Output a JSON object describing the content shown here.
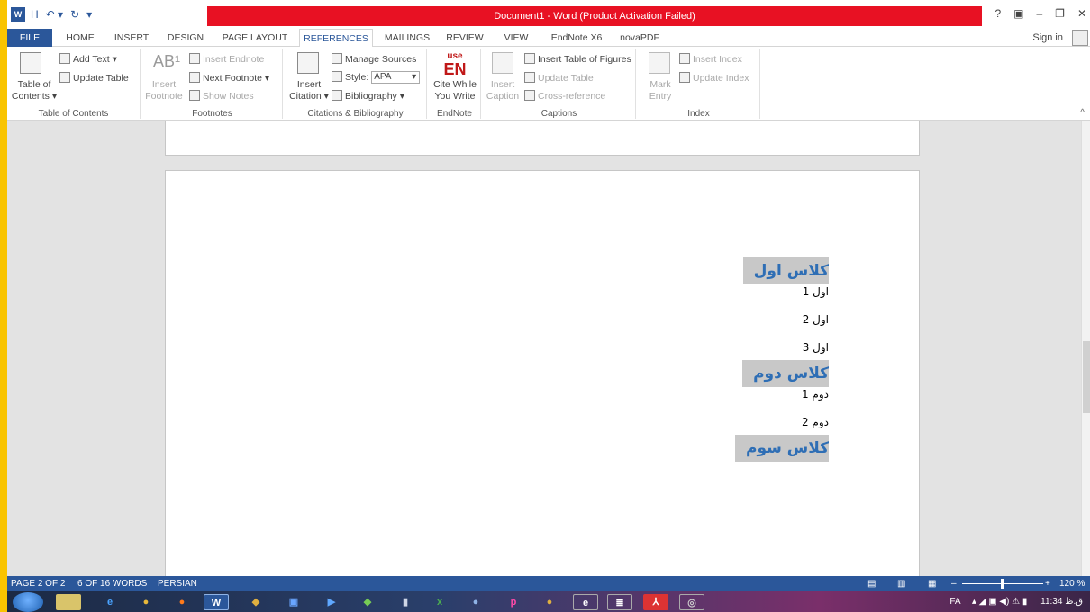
{
  "window": {
    "title": "Document1 - Word (Product Activation Failed)",
    "help": "?",
    "minimize": "–",
    "restore": "❐",
    "close": "✕"
  },
  "qat": {
    "save": "H",
    "undo": "↶ ▾",
    "redo": "↻"
  },
  "tabs": [
    "FILE",
    "HOME",
    "INSERT",
    "DESIGN",
    "PAGE LAYOUT",
    "REFERENCES",
    "MAILINGS",
    "REVIEW",
    "VIEW",
    "EndNote X6",
    "novaPDF"
  ],
  "sign_in": "Sign in",
  "ribbon": {
    "toc": {
      "table_of_contents": "Table of",
      "table_of_contents2": "Contents ▾",
      "add_text": "Add Text ▾",
      "update_table": "Update Table",
      "label": "Table of Contents"
    },
    "footnotes": {
      "insert_footnote": "Insert",
      "insert_footnote2": "Footnote",
      "insert_endnote": "Insert Endnote",
      "next_footnote": "Next Footnote ▾",
      "show_notes": "Show Notes",
      "label": "Footnotes"
    },
    "citations": {
      "insert_citation": "Insert",
      "insert_citation2": "Citation ▾",
      "manage_sources": "Manage Sources",
      "style_label": "Style:",
      "style_value": "APA",
      "bibliography": "Bibliography ▾",
      "label": "Citations & Bibliography"
    },
    "endnote": {
      "logo_use": "use",
      "logo_en": "EN",
      "cite_while": "Cite While",
      "you_write": "You Write",
      "label": "EndNote"
    },
    "captions": {
      "insert_caption": "Insert",
      "insert_caption2": "Caption",
      "insert_tof": "Insert Table of Figures",
      "update_table": "Update Table",
      "cross_reference": "Cross-reference",
      "label": "Captions"
    },
    "index": {
      "mark_entry": "Mark",
      "mark_entry2": "Entry",
      "insert_index": "Insert Index",
      "update_index": "Update Index",
      "label": "Index"
    }
  },
  "document": {
    "sections": [
      {
        "heading": "کلاس اول",
        "items": [
          "اول 1",
          "اول 2",
          "اول 3"
        ]
      },
      {
        "heading": "کلاس دوم",
        "items": [
          "دوم 1",
          "دوم 2"
        ]
      },
      {
        "heading": "کلاس سوم",
        "items": []
      }
    ]
  },
  "status": {
    "page": "PAGE 2 OF 2",
    "words": "6 OF 16 WORDS",
    "language": "PERSIAN",
    "zoom": "120 %"
  },
  "taskbar": {
    "lang": "FA",
    "clock": "11:34 ق.ظ"
  },
  "colors": {
    "word_blue": "#2b579a",
    "title_red": "#e81123",
    "heading_blue": "#2e6eb5",
    "heading_bg": "#c8c8c8",
    "desktop_yellow": "#f9c400"
  }
}
